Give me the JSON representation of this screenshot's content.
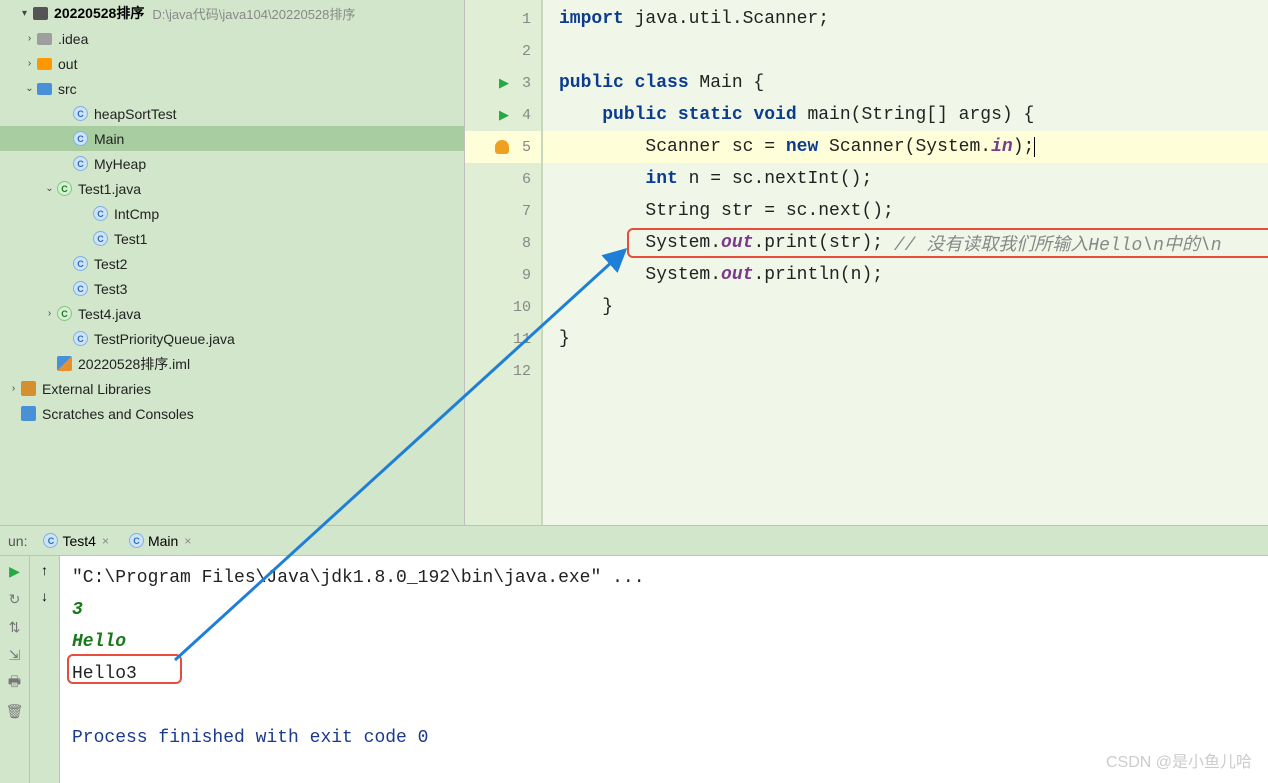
{
  "project": {
    "name": "20220528排序",
    "path": "D:\\java代码\\java104\\20220528排序"
  },
  "tree": [
    {
      "indent": 22,
      "chev": "right",
      "icon": "folder-gray",
      "label": ".idea"
    },
    {
      "indent": 22,
      "chev": "right",
      "icon": "folder-orange",
      "label": "out"
    },
    {
      "indent": 22,
      "chev": "down",
      "icon": "folder-blue",
      "label": "src"
    },
    {
      "indent": 58,
      "chev": "",
      "icon": "c-blue",
      "label": "heapSortTest"
    },
    {
      "indent": 58,
      "chev": "",
      "icon": "c-blue",
      "label": "Main",
      "selected": true
    },
    {
      "indent": 58,
      "chev": "",
      "icon": "c-blue",
      "label": "MyHeap"
    },
    {
      "indent": 42,
      "chev": "down",
      "icon": "c-green",
      "label": "Test1.java"
    },
    {
      "indent": 78,
      "chev": "",
      "icon": "c-blue",
      "label": "IntCmp"
    },
    {
      "indent": 78,
      "chev": "",
      "icon": "c-blue",
      "label": "Test1"
    },
    {
      "indent": 58,
      "chev": "",
      "icon": "c-blue",
      "label": "Test2"
    },
    {
      "indent": 58,
      "chev": "",
      "icon": "c-blue",
      "label": "Test3"
    },
    {
      "indent": 42,
      "chev": "right",
      "icon": "c-green",
      "label": "Test4.java"
    },
    {
      "indent": 58,
      "chev": "",
      "icon": "c-blue",
      "label": "TestPriorityQueue.java"
    },
    {
      "indent": 42,
      "chev": "",
      "icon": "iml",
      "label": "20220528排序.iml"
    },
    {
      "indent": 6,
      "chev": "right",
      "icon": "lib",
      "label": "External Libraries"
    },
    {
      "indent": 6,
      "chev": "",
      "icon": "scratch",
      "label": "Scratches and Consoles"
    }
  ],
  "gutter": [
    {
      "num": "1"
    },
    {
      "num": "2"
    },
    {
      "num": "3",
      "run": true
    },
    {
      "num": "4",
      "run": true
    },
    {
      "num": "5",
      "bulb": true,
      "active": true
    },
    {
      "num": "6"
    },
    {
      "num": "7"
    },
    {
      "num": "8"
    },
    {
      "num": "9"
    },
    {
      "num": "10"
    },
    {
      "num": "11"
    },
    {
      "num": "12"
    }
  ],
  "code": {
    "l1_import": "import",
    "l1_rest": " java.util.Scanner;",
    "l3_public": "public class",
    "l3_rest": " Main {",
    "l4_pre": "    ",
    "l4_public": "public static void",
    "l4_rest": " main(String[] args) {",
    "l5_pre": "        Scanner sc = ",
    "l5_new": "new",
    "l5_mid": " Scanner(System.",
    "l5_in": "in",
    "l5_end": ");",
    "l6_pre": "        ",
    "l6_int": "int",
    "l6_rest": " n = sc.nextInt();",
    "l7": "        String str = sc.next();",
    "l8_pre": "        System.",
    "l8_out": "out",
    "l8_mid": ".print(str); ",
    "l8_comment": "// 没有读取我们所输入Hello\\n中的\\n",
    "l9_pre": "        System.",
    "l9_out": "out",
    "l9_rest": ".println(n);",
    "l10": "    }",
    "l11": "}"
  },
  "run": {
    "label": "un:",
    "tabs": [
      {
        "icon": "c-blue",
        "label": "Test4"
      },
      {
        "icon": "c-blue",
        "label": "Main"
      }
    ]
  },
  "console": {
    "cmd": "\"C:\\Program Files\\Java\\jdk1.8.0_192\\bin\\java.exe\" ...",
    "in1": "3",
    "in2": "Hello",
    "out1": "Hello3",
    "exit": "Process finished with exit code 0"
  },
  "watermark": "CSDN @是小鱼儿哈"
}
